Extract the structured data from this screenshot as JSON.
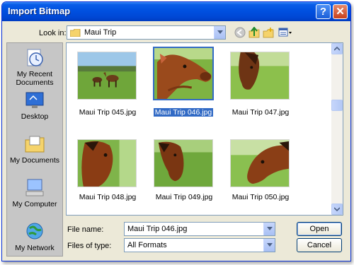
{
  "window": {
    "title": "Import Bitmap"
  },
  "toolbar": {
    "look_in_label": "Look in:",
    "look_in_value": "Maui Trip",
    "icons": [
      "back-icon",
      "up-folder-icon",
      "new-folder-icon",
      "view-menu-icon"
    ]
  },
  "places": [
    {
      "label": "My Recent Documents"
    },
    {
      "label": "Desktop"
    },
    {
      "label": "My Documents"
    },
    {
      "label": "My Computer"
    },
    {
      "label": "My Network"
    }
  ],
  "files": [
    {
      "name": "Maui Trip 045.jpg",
      "selected": false
    },
    {
      "name": "Maui Trip 046.jpg",
      "selected": true
    },
    {
      "name": "Maui Trip 047.jpg",
      "selected": false
    },
    {
      "name": "Maui Trip 048.jpg",
      "selected": false
    },
    {
      "name": "Maui Trip 049.jpg",
      "selected": false
    },
    {
      "name": "Maui Trip 050.jpg",
      "selected": false
    }
  ],
  "form": {
    "filename_label": "File name:",
    "filename_value": "Maui Trip 046.jpg",
    "filetype_label": "Files of type:",
    "filetype_value": "All Formats"
  },
  "buttons": {
    "open": "Open",
    "cancel": "Cancel"
  },
  "colors": {
    "titlebar": "#0050e0",
    "selection": "#316ac5",
    "dialog_bg": "#ece9d8",
    "sidebar": "#c6c6c6"
  }
}
